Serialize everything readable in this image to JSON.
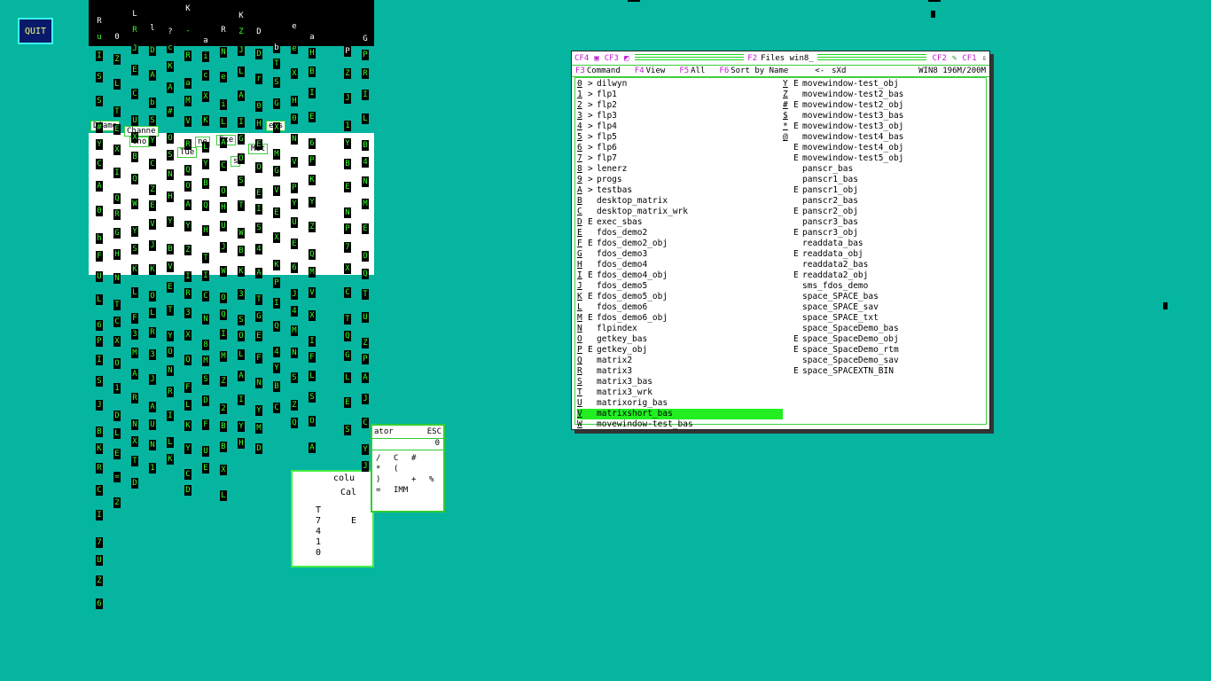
{
  "quit_label": "QUIT",
  "matrix": {
    "ghost_texts": [
      "Diamo",
      "Channe",
      "Cho",
      "ne",
      "Exe",
      "Tue",
      "s",
      "Met",
      "egs",
      "colu",
      "Cal",
      "T",
      "E",
      "7",
      "4",
      "1",
      "0"
    ],
    "columns": [
      [
        "R",
        "u",
        "I",
        "S",
        "S",
        "#",
        "Y",
        "C",
        "A",
        "0",
        "h",
        "F",
        "U",
        "L",
        "6",
        "P",
        "I",
        "S",
        "J",
        "B",
        "K",
        "R",
        "C",
        "I",
        "7",
        "U",
        "Z",
        "6"
      ],
      [
        "0",
        "Z",
        "L",
        "T",
        "E",
        "X",
        "I",
        "Q",
        "R",
        "G",
        "H",
        "N",
        "T",
        "C",
        "X",
        "O",
        "1",
        "D",
        "L",
        "E",
        "=",
        "2"
      ],
      [
        "L",
        "R",
        "J",
        "E",
        "C",
        "U",
        "X",
        "B",
        "Q",
        "W",
        "Y",
        "S",
        "K",
        "L",
        "F",
        "3",
        "M",
        "A",
        "R",
        "N",
        "X",
        "T",
        "D"
      ],
      [
        "l",
        "D",
        "A",
        "b",
        "S",
        "Y",
        "C",
        "Z",
        "E",
        "V",
        "J",
        "K",
        "O",
        "L",
        "R",
        "3",
        "J",
        "A",
        "U",
        "N",
        "1"
      ],
      [
        "?",
        "c",
        "K",
        "A",
        "#",
        "O",
        "S",
        "N",
        "H",
        "Y",
        "B",
        "V",
        "E",
        "T",
        "Y",
        "O",
        "N",
        "R",
        "I",
        "L",
        "K"
      ],
      [
        "K",
        "-",
        "R",
        "a",
        "M",
        "V",
        "R",
        "Q",
        "O",
        "A",
        "Y",
        "Z",
        "I",
        "R",
        "3",
        "X",
        "Q",
        "F",
        "L",
        "K",
        "Y",
        "C",
        "D"
      ],
      [
        "a",
        "i",
        "c",
        "X",
        "K",
        "L",
        "Y",
        "B",
        "Q",
        "H",
        "T",
        "I",
        "C",
        "N",
        "8",
        "M",
        "S",
        "D",
        "F",
        "U",
        "E"
      ],
      [
        "R",
        "N",
        "e",
        "i",
        "L",
        "A",
        "C",
        "O",
        "H",
        "U",
        "J",
        "W",
        "O",
        "Q",
        "I",
        "M",
        "Z",
        "2",
        "B",
        "B",
        "X",
        "L"
      ],
      [
        "K",
        "Z",
        "J",
        "L",
        "A",
        "I",
        "G",
        "O",
        "S",
        "T",
        "W",
        "B",
        "K",
        "3",
        "S",
        "O",
        "L",
        "A",
        "I",
        "Y",
        "H"
      ],
      [
        "D",
        "D",
        "r",
        "0",
        "H",
        "E",
        "O",
        "E",
        "I",
        "S",
        "4",
        "A",
        "T",
        "G",
        "E",
        "F",
        "N",
        "Y",
        "M",
        "D"
      ],
      [
        "b",
        "T",
        "S",
        "G",
        "X",
        "M",
        "G",
        "V",
        "E",
        "X",
        "K",
        "P",
        "I",
        "Q",
        "4",
        "Y",
        "B",
        "C"
      ],
      [
        "e",
        "e",
        "X",
        "H",
        "0",
        "N",
        "V",
        "P",
        "Y",
        "U",
        "E",
        "6",
        "J",
        "4",
        "M",
        "N",
        "S",
        "Z",
        "Q"
      ],
      [
        "a",
        "H",
        "B",
        "I",
        "E",
        "6",
        "P",
        "K",
        "Y",
        "Z",
        "Q",
        "M",
        "V",
        "X",
        "I",
        "F",
        "L",
        "S",
        "O",
        "A"
      ],
      [
        "P",
        "Z",
        "J",
        "1",
        "Y",
        "B",
        "E",
        "N",
        "P",
        "7",
        "X",
        "C",
        "T",
        "Q",
        "G",
        "L",
        "E",
        "S"
      ],
      [
        "G",
        "P",
        "R",
        "I",
        "L",
        "B",
        "4",
        "N",
        "M",
        "E",
        "O",
        "Q",
        "T",
        "U",
        "Z",
        "P",
        "A",
        "J",
        "C",
        "Y",
        "J"
      ]
    ]
  },
  "calculator": {
    "title_fragment": "ator",
    "esc_label": "ESC",
    "display": "0",
    "keys": [
      "/",
      "C",
      "#",
      "",
      "*",
      "(",
      "",
      "",
      ")",
      "",
      "+",
      "%",
      "=",
      "IMM",
      "",
      ""
    ]
  },
  "files": {
    "toolbar_left": [
      "CF4",
      "CF3"
    ],
    "title_key": "F2",
    "title": "Files win8_",
    "toolbar_right": [
      "CF2",
      "CF1"
    ],
    "menu": [
      {
        "key": "F3",
        "label": "Command"
      },
      {
        "key": "F4",
        "label": "View"
      },
      {
        "key": "F5",
        "label": "All"
      },
      {
        "key": "F6",
        "label": "Sort by Name"
      }
    ],
    "path_arrow": "<-",
    "path": "sXd",
    "drive_info": "WIN8 196M/200M",
    "left_entries": [
      {
        "key": "0",
        "mark": ">",
        "name": "dilwyn"
      },
      {
        "key": "1",
        "mark": ">",
        "name": "flp1"
      },
      {
        "key": "2",
        "mark": ">",
        "name": "flp2"
      },
      {
        "key": "3",
        "mark": ">",
        "name": "flp3"
      },
      {
        "key": "4",
        "mark": ">",
        "name": "flp4"
      },
      {
        "key": "5",
        "mark": ">",
        "name": "flp5"
      },
      {
        "key": "6",
        "mark": ">",
        "name": "flp6"
      },
      {
        "key": "7",
        "mark": ">",
        "name": "flp7"
      },
      {
        "key": "8",
        "mark": ">",
        "name": "lenerz"
      },
      {
        "key": "9",
        "mark": ">",
        "name": "progs"
      },
      {
        "key": "A",
        "mark": ">",
        "name": "testbas"
      },
      {
        "key": "B",
        "mark": "",
        "name": "desktop_matrix"
      },
      {
        "key": "C",
        "mark": "",
        "name": "desktop_matrix_wrk"
      },
      {
        "key": "D",
        "mark": "E",
        "name": "exec_sbas"
      },
      {
        "key": "E",
        "mark": "",
        "name": "fdos_demo2"
      },
      {
        "key": "F",
        "mark": "E",
        "name": "fdos_demo2_obj"
      },
      {
        "key": "G",
        "mark": "",
        "name": "fdos_demo3"
      },
      {
        "key": "H",
        "mark": "",
        "name": "fdos_demo4"
      },
      {
        "key": "I",
        "mark": "E",
        "name": "fdos_demo4_obj"
      },
      {
        "key": "J",
        "mark": "",
        "name": "fdos_demo5"
      },
      {
        "key": "K",
        "mark": "E",
        "name": "fdos_demo5_obj"
      },
      {
        "key": "L",
        "mark": "",
        "name": "fdos_demo6"
      },
      {
        "key": "M",
        "mark": "E",
        "name": "fdos_demo6_obj"
      },
      {
        "key": "N",
        "mark": "",
        "name": "flpindex"
      },
      {
        "key": "O",
        "mark": "",
        "name": "getkey_bas"
      },
      {
        "key": "P",
        "mark": "E",
        "name": "getkey_obj"
      },
      {
        "key": "Q",
        "mark": "",
        "name": "matrix2"
      },
      {
        "key": "R",
        "mark": "",
        "name": "matrix3"
      },
      {
        "key": "S",
        "mark": "",
        "name": "matrix3_bas"
      },
      {
        "key": "T",
        "mark": "",
        "name": "matrix3_wrk"
      },
      {
        "key": "U",
        "mark": "",
        "name": "matrixorig_bas"
      },
      {
        "key": "V",
        "mark": "",
        "name": "matrixshort_bas"
      },
      {
        "key": "W",
        "mark": "",
        "name": "movewindow-test_bas"
      }
    ],
    "right_entries": [
      {
        "key": "Y",
        "mark": "E",
        "name": "movewindow-test_obj"
      },
      {
        "key": "Z",
        "mark": "",
        "name": "movewindow-test2_bas"
      },
      {
        "key": "#",
        "mark": "E",
        "name": "movewindow-test2_obj"
      },
      {
        "key": "$",
        "mark": "",
        "name": "movewindow-test3_bas"
      },
      {
        "key": "*",
        "mark": "E",
        "name": "movewindow-test3_obj"
      },
      {
        "key": "@",
        "mark": "",
        "name": "movewindow-test4_bas"
      },
      {
        "key": "",
        "mark": "E",
        "name": "movewindow-test4_obj"
      },
      {
        "key": "",
        "mark": "E",
        "name": "movewindow-test5_obj"
      },
      {
        "key": "",
        "mark": "",
        "name": "panscr_bas"
      },
      {
        "key": "",
        "mark": "",
        "name": "panscr1_bas"
      },
      {
        "key": "",
        "mark": "E",
        "name": "panscr1_obj"
      },
      {
        "key": "",
        "mark": "",
        "name": "panscr2_bas"
      },
      {
        "key": "",
        "mark": "E",
        "name": "panscr2_obj"
      },
      {
        "key": "",
        "mark": "",
        "name": "panscr3_bas"
      },
      {
        "key": "",
        "mark": "E",
        "name": "panscr3_obj"
      },
      {
        "key": "",
        "mark": "",
        "name": "readdata_bas"
      },
      {
        "key": "",
        "mark": "E",
        "name": "readdata_obj"
      },
      {
        "key": "",
        "mark": "",
        "name": "readdata2_bas"
      },
      {
        "key": "",
        "mark": "E",
        "name": "readdata2_obj"
      },
      {
        "key": "",
        "mark": "",
        "name": "sms_fdos_demo"
      },
      {
        "key": "",
        "mark": "",
        "name": "space_SPACE_bas"
      },
      {
        "key": "",
        "mark": "",
        "name": "space_SPACE_sav"
      },
      {
        "key": "",
        "mark": "",
        "name": "space_SPACE_txt"
      },
      {
        "key": "",
        "mark": "",
        "name": "space_SpaceDemo_bas"
      },
      {
        "key": "",
        "mark": "E",
        "name": "space_SpaceDemo_obj"
      },
      {
        "key": "",
        "mark": "E",
        "name": "space_SpaceDemo_rtm"
      },
      {
        "key": "",
        "mark": "",
        "name": "space_SpaceDemo_sav"
      },
      {
        "key": "",
        "mark": "E",
        "name": "space_SPACEXTN_BIN"
      }
    ],
    "selected_index": 31
  },
  "colors": {
    "desktop": "#05b5a0",
    "matrix_green": "#36ff2b",
    "selection": "#22ee22",
    "title_magenta": "#c01ad0"
  }
}
